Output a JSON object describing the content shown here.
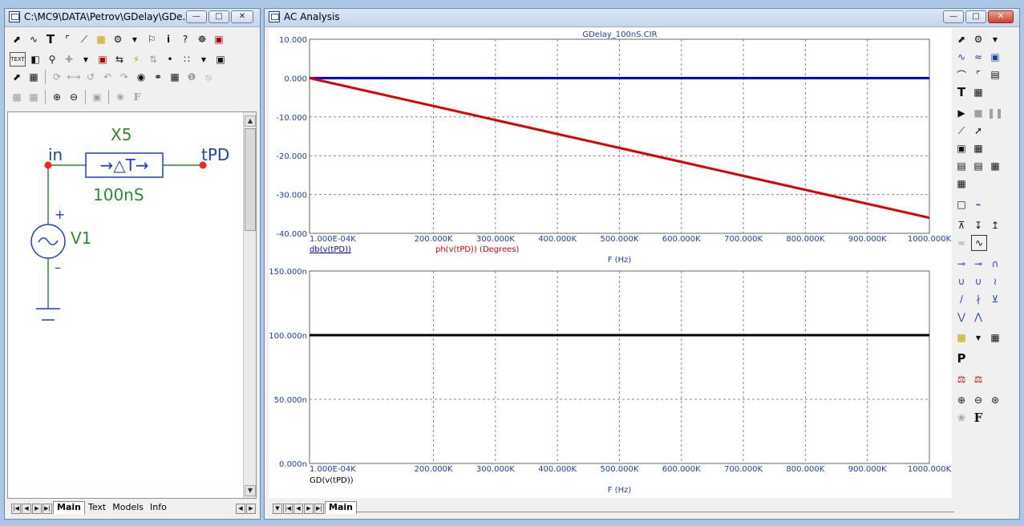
{
  "schematic_window": {
    "title": "C:\\MC9\\DATA\\Petrov\\GDelay\\GDe...",
    "toolbar_row1": [
      "select-arrow",
      "wire",
      "text",
      "ortho-wire",
      "line",
      "info-box",
      "component",
      "dropdown",
      "flag",
      "info",
      "help",
      "probe",
      "options"
    ],
    "tabs": [
      {
        "label": "Main"
      },
      {
        "label": "Text"
      },
      {
        "label": "Models"
      },
      {
        "label": "Info"
      }
    ],
    "toolbar_text_label": "TEXT",
    "circuit": {
      "component_name": "X5",
      "component_symbol": "→△T→",
      "component_value": "100nS",
      "input_node": "in",
      "output_node": "tPD",
      "source_name": "V1",
      "plus": "+",
      "minus": "–"
    }
  },
  "ac_window": {
    "title": "AC Analysis",
    "tabs": [
      {
        "label": "Main"
      }
    ],
    "plot1": {
      "circuit_name": "GDelay_100nS.CIR",
      "y_ticks": [
        "10.000",
        "0.000",
        "-10.000",
        "-20.000",
        "-30.000",
        "-40.000"
      ],
      "x_ticks": [
        "1.000E-04K",
        "200.000K",
        "300.000K",
        "400.000K",
        "500.000K",
        "600.000K",
        "700.000K",
        "800.000K",
        "900.000K",
        "1000.000K"
      ],
      "xlabel": "F (Hz)",
      "trace1_label": "db(v(tPD))",
      "trace2_label": "ph(v(tPD)) (Degrees)",
      "colors": {
        "trace1": "#0000dd",
        "trace2": "#dd0000"
      }
    },
    "plot2": {
      "y_ticks": [
        "150.000n",
        "100.000n",
        "50.000n",
        "0.000n"
      ],
      "x_ticks": [
        "1.000E-04K",
        "200.000K",
        "300.000K",
        "400.000K",
        "500.000K",
        "600.000K",
        "700.000K",
        "800.000K",
        "900.000K",
        "1000.000K"
      ],
      "xlabel": "F (Hz)",
      "trace_label": "GD(v(tPD))",
      "colors": {
        "trace": "#000000"
      }
    },
    "scale_letter": "P"
  },
  "chart_data": [
    {
      "type": "line",
      "title": "GDelay_100nS.CIR",
      "xlabel": "F (Hz)",
      "ylabel": "",
      "xlim": [
        100,
        1000000
      ],
      "ylim": [
        -40,
        10
      ],
      "series": [
        {
          "name": "db(v(tPD))",
          "x": [
            100,
            1000000
          ],
          "y": [
            0,
            0
          ]
        },
        {
          "name": "ph(v(tPD)) (Degrees)",
          "x": [
            100,
            100000,
            200000,
            300000,
            400000,
            500000,
            600000,
            700000,
            800000,
            900000,
            1000000
          ],
          "y": [
            0,
            -3.6,
            -7.2,
            -10.8,
            -14.4,
            -18.0,
            -21.6,
            -25.2,
            -28.8,
            -32.4,
            -36.0
          ]
        }
      ],
      "grid": true
    },
    {
      "type": "line",
      "title": "",
      "xlabel": "F (Hz)",
      "ylabel": "",
      "xlim": [
        100,
        1000000
      ],
      "ylim": [
        0,
        150
      ],
      "y_unit": "n",
      "series": [
        {
          "name": "GD(v(tPD))",
          "x": [
            100,
            1000000
          ],
          "y": [
            100,
            100
          ]
        }
      ],
      "grid": true
    }
  ]
}
